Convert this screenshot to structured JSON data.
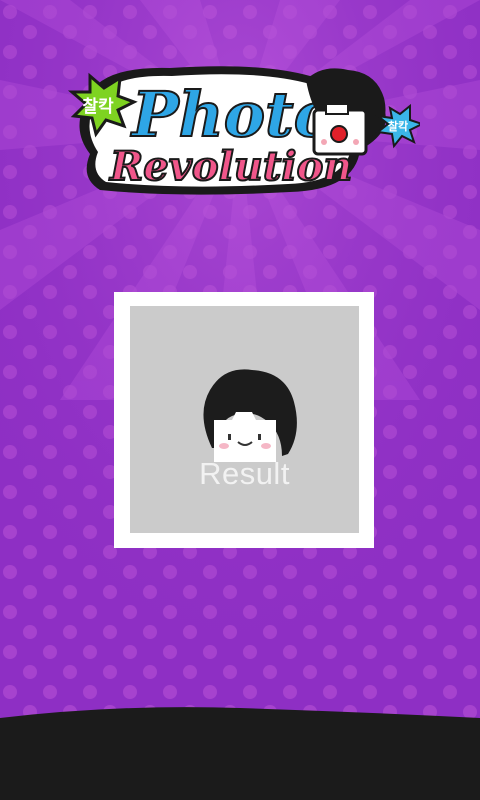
{
  "app": {
    "title_line1": "Photo",
    "title_line2": "Revolution",
    "badge_left": "찰칵",
    "badge_right": "찰칵"
  },
  "result_button": {
    "label": "Result"
  },
  "colors": {
    "background": "#8e2fc4",
    "title_blue": "#2ea6e6",
    "title_pink": "#f0568a",
    "badge_green": "#7ed321",
    "badge_blue": "#3ab6e8",
    "result_bg": "#cbcbcb",
    "bottom_bar": "#1b1b1b"
  },
  "icons": {
    "mascot": "mascot-face-icon",
    "camera": "camera-mascot-icon"
  }
}
